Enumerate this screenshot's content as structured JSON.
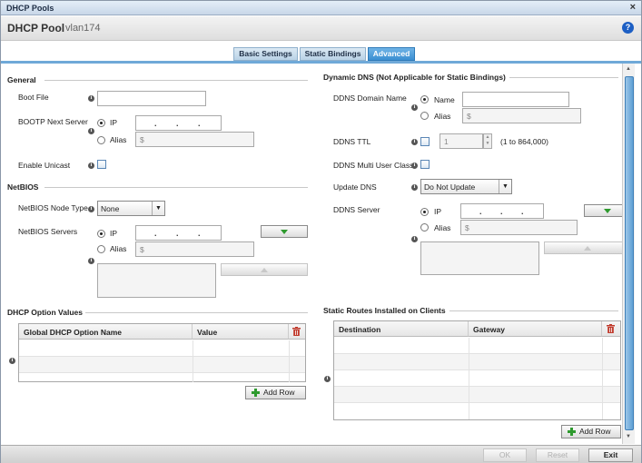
{
  "window": {
    "title": "DHCP Pools"
  },
  "header": {
    "title": "DHCP Pool",
    "pool_name": "vlan174"
  },
  "tabs": [
    {
      "label": "Basic Settings"
    },
    {
      "label": "Static Bindings"
    },
    {
      "label": "Advanced"
    }
  ],
  "general": {
    "heading": "General",
    "boot_file_label": "Boot File",
    "bootp_label": "BOOTP Next Server",
    "ip_label": "IP",
    "alias_label": "Alias",
    "alias_placeholder": "$",
    "unicast_label": "Enable Unicast"
  },
  "netbios": {
    "heading": "NetBIOS",
    "node_type_label": "NetBIOS Node Type",
    "node_type_value": "None",
    "servers_label": "NetBIOS Servers",
    "ip_label": "IP",
    "alias_label": "Alias",
    "alias_placeholder": "$"
  },
  "dhcp_options": {
    "heading": "DHCP Option Values",
    "col_name": "Global DHCP Option Name",
    "col_value": "Value",
    "add_row": "Add Row"
  },
  "ddns": {
    "heading": "Dynamic DNS (Not Applicable for Static Bindings)",
    "domain_label": "DDNS Domain Name",
    "name_label": "Name",
    "alias_label": "Alias",
    "alias_placeholder": "$",
    "ttl_label": "DDNS TTL",
    "ttl_value": "1",
    "ttl_range": "(1 to 864,000)",
    "multi_user_label": "DDNS Multi User Class",
    "update_label": "Update DNS",
    "update_value": "Do Not Update",
    "server_label": "DDNS Server",
    "ip_label": "IP"
  },
  "static_routes": {
    "heading": "Static Routes Installed on Clients",
    "col_dest": "Destination",
    "col_gw": "Gateway",
    "add_row": "Add Row"
  },
  "footer": {
    "ok": "OK",
    "reset": "Reset",
    "exit": "Exit"
  },
  "colors": {
    "accent": "#3b8fd2",
    "green": "#2e9a2e",
    "trash": "#c0392b"
  }
}
